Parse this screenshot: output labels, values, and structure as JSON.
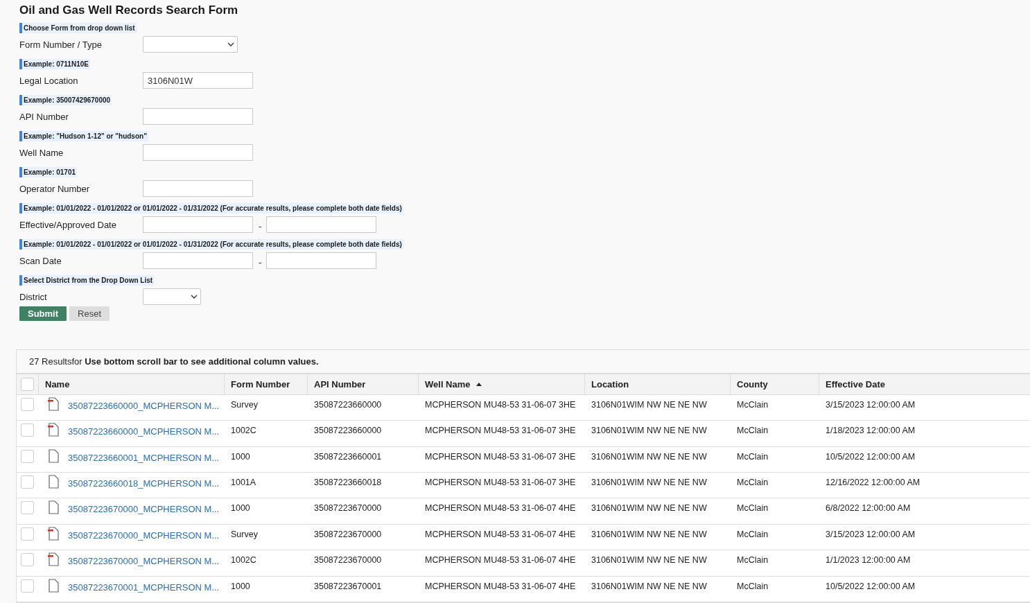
{
  "title": "Oil and Gas Well Records Search Form",
  "fields": [
    {
      "hint": "Choose Form from drop down list",
      "label": "Form Number / Type",
      "kind": "select"
    },
    {
      "hint": "Example: 0711N10E",
      "label": "Legal Location",
      "kind": "text",
      "value": "3106N01W"
    },
    {
      "hint": "Example: 35007429670000",
      "label": "API Number",
      "kind": "text"
    },
    {
      "hint": "Example: \"Hudson 1-12\" or \"hudson\"",
      "label": "Well Name",
      "kind": "text"
    },
    {
      "hint": "Example: 01701",
      "label": "Operator Number",
      "kind": "text"
    },
    {
      "hint": "Example: 01/01/2022 - 01/01/2022 or 01/01/2022 - 01/31/2022 (For accurate results, please complete both date fields)",
      "label": "Effective/Approved Date",
      "kind": "range",
      "separator": "-"
    },
    {
      "hint": "Example: 01/01/2022 - 01/01/2022 or 01/01/2022 - 01/31/2022 (For accurate results, please complete both date fields)",
      "label": "Scan Date",
      "kind": "range",
      "separator": "-"
    },
    {
      "hint": "Select District from the Drop Down List",
      "label": "District",
      "kind": "select"
    }
  ],
  "buttons": [
    {
      "label": "Submit",
      "kind": "primary"
    },
    {
      "label": "Reset",
      "kind": "secondary"
    }
  ],
  "results": {
    "count": "27 Resultsfor",
    "note": "Use bottom scroll bar to see additional column values.",
    "select_all": {
      "checked": false
    },
    "columns": [
      {
        "label": "Name",
        "sorted": false
      },
      {
        "label": "Form Number",
        "sorted": false
      },
      {
        "label": "API Number",
        "sorted": false
      },
      {
        "label": "Well Name",
        "sorted": true
      },
      {
        "label": "Location",
        "sorted": false
      },
      {
        "label": "County",
        "sorted": false
      },
      {
        "label": "Effective Date",
        "sorted": false
      }
    ],
    "rows": [
      {
        "checked": false,
        "pdf": true,
        "name": "35087223660000_MCPHERSON M...",
        "form": "Survey",
        "api": "35087223660000",
        "well": "MCPHERSON MU48-53 31-06-07 3HE",
        "location": "3106N01WIM NW NE NE NW",
        "county": "McClain",
        "date": "3/15/2023 12:00:00 AM"
      },
      {
        "checked": false,
        "pdf": true,
        "name": "35087223660000_MCPHERSON M...",
        "form": "1002C",
        "api": "35087223660000",
        "well": "MCPHERSON MU48-53 31-06-07 3HE",
        "location": "3106N01WIM NW NE NE NW",
        "county": "McClain",
        "date": "1/18/2023 12:00:00 AM"
      },
      {
        "checked": false,
        "pdf": false,
        "name": "35087223660001_MCPHERSON M...",
        "form": "1000",
        "api": "35087223660001",
        "well": "MCPHERSON MU48-53 31-06-07 3HE",
        "location": "3106N01WIM NW NE NE NW",
        "county": "McClain",
        "date": "10/5/2022 12:00:00 AM"
      },
      {
        "checked": false,
        "pdf": false,
        "name": "35087223660018_MCPHERSON M...",
        "form": "1001A",
        "api": "35087223660018",
        "well": "MCPHERSON MU48-53 31-06-07 3HE",
        "location": "3106N01WIM NW NE NE NW",
        "county": "McClain",
        "date": "12/16/2022 12:00:00 AM"
      },
      {
        "checked": false,
        "pdf": false,
        "name": "35087223670000_MCPHERSON M...",
        "form": "1000",
        "api": "35087223670000",
        "well": "MCPHERSON MU48-53 31-06-07 4HE",
        "location": "3106N01WIM NW NE NE NW",
        "county": "McClain",
        "date": "6/8/2022 12:00:00 AM"
      },
      {
        "checked": false,
        "pdf": true,
        "name": "35087223670000_MCPHERSON M...",
        "form": "Survey",
        "api": "35087223670000",
        "well": "MCPHERSON MU48-53 31-06-07 4HE",
        "location": "3106N01WIM NW NE NE NW",
        "county": "McClain",
        "date": "3/15/2023 12:00:00 AM"
      },
      {
        "checked": false,
        "pdf": true,
        "name": "35087223670000_MCPHERSON M...",
        "form": "1002C",
        "api": "35087223670000",
        "well": "MCPHERSON MU48-53 31-06-07 4HE",
        "location": "3106N01WIM NW NE NE NW",
        "county": "McClain",
        "date": "1/1/2023 12:00:00 AM"
      },
      {
        "checked": false,
        "pdf": false,
        "name": "35087223670001_MCPHERSON M...",
        "form": "1000",
        "api": "35087223670001",
        "well": "MCPHERSON MU48-53 31-06-07 4HE",
        "location": "3106N01WIM NW NE NE NW",
        "county": "McClain",
        "date": "10/5/2022 12:00:00 AM"
      }
    ]
  }
}
